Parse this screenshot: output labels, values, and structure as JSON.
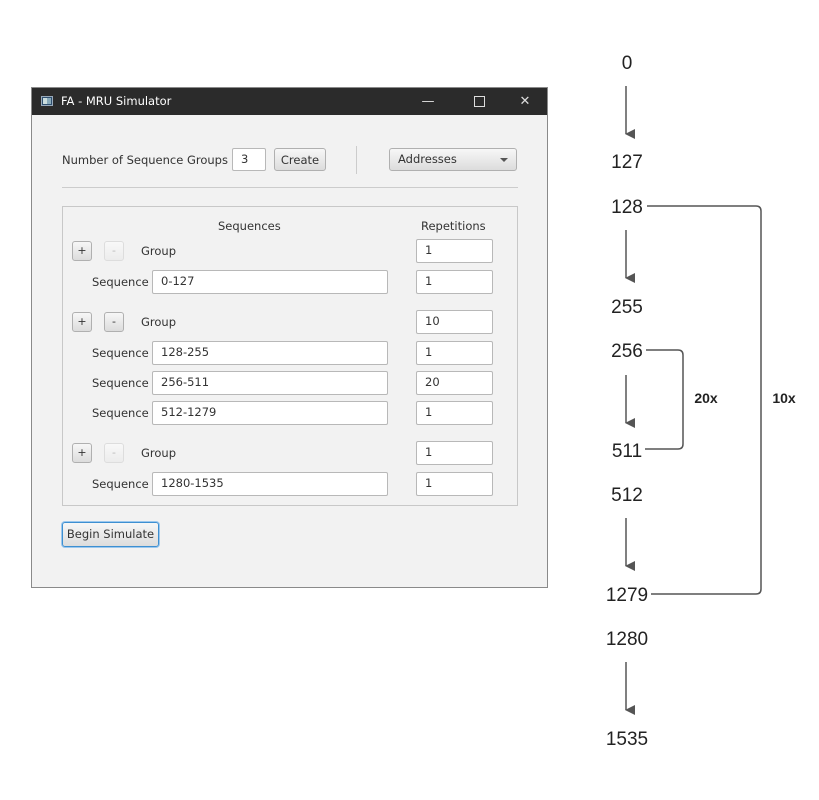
{
  "window": {
    "title": "FA - MRU Simulator",
    "controls": {
      "minimize": "—",
      "close": "✕"
    }
  },
  "toolbar": {
    "groups_label": "Number of Sequence Groups",
    "groups_value": "3",
    "create_label": "Create",
    "mode_select": "Addresses"
  },
  "panel": {
    "col_sequences": "Sequences",
    "col_repetitions": "Repetitions",
    "add_label": "+",
    "remove_label": "-",
    "group_label": "Group",
    "sequence_label": "Sequence",
    "groups": [
      {
        "repetitions": "1",
        "sequences": [
          {
            "range": "0-127",
            "repetitions": "1"
          }
        ]
      },
      {
        "repetitions": "10",
        "sequences": [
          {
            "range": "128-255",
            "repetitions": "1"
          },
          {
            "range": "256-511",
            "repetitions": "20"
          },
          {
            "range": "512-1279",
            "repetitions": "1"
          }
        ]
      },
      {
        "repetitions": "1",
        "sequences": [
          {
            "range": "1280-1535",
            "repetitions": "1"
          }
        ]
      }
    ]
  },
  "begin_label": "Begin Simulate",
  "diagram": {
    "numbers": [
      "0",
      "127",
      "128",
      "255",
      "256",
      "511",
      "512",
      "1279",
      "1280",
      "1535"
    ],
    "inner_loop_label": "20x",
    "outer_loop_label": "10x"
  }
}
